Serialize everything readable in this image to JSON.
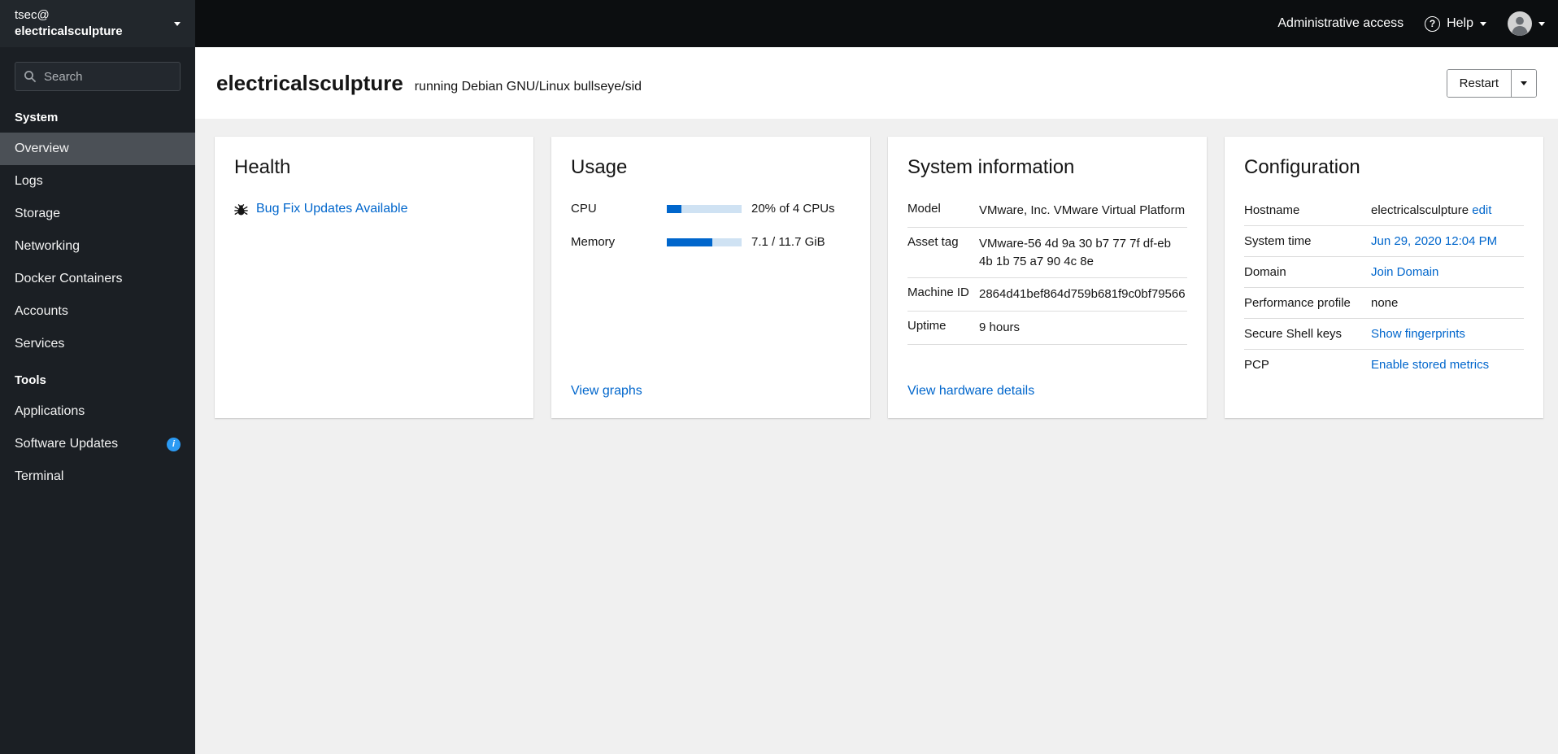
{
  "colors": {
    "link": "#0066cc",
    "progress_fill": "#0066cc",
    "progress_track": "#cfe2f3",
    "info_badge": "#2b9af3",
    "sidebar_active_bg": "#4b5056",
    "topbar_bg": "#0c0e10",
    "sidebar_bg": "#1b1f24"
  },
  "icons": {
    "search-icon": "magnifier",
    "chevron-down-icon": "caret-down-triangle",
    "help-icon": "question-circle",
    "avatar-icon": "user-silhouette",
    "bug-icon": "bug",
    "info-icon": "i-circle"
  },
  "topbar": {
    "administrative_access_label": "Administrative access",
    "help_label": "Help"
  },
  "sidebar": {
    "host_switcher": {
      "user": "tsec@",
      "host": "electricalsculpture"
    },
    "search": {
      "placeholder": "Search"
    },
    "sections": [
      {
        "label": "System",
        "items": [
          "Overview",
          "Logs",
          "Storage",
          "Networking",
          "Docker Containers",
          "Accounts",
          "Services"
        ]
      },
      {
        "label": "Tools",
        "items": [
          "Applications",
          "Software Updates",
          "Terminal"
        ]
      }
    ],
    "active_item": "Overview"
  },
  "header": {
    "hostname": "electricalsculpture",
    "os_release": "running Debian GNU/Linux bullseye/sid",
    "restart_label": "Restart"
  },
  "cards": {
    "health": {
      "title": "Health",
      "updates_link": "Bug Fix Updates Available"
    },
    "usage": {
      "title": "Usage",
      "rows": [
        {
          "label": "CPU",
          "value": "20% of 4 CPUs",
          "percent": 20
        },
        {
          "label": "Memory",
          "value": "7.1 / 11.7 GiB",
          "percent": 61
        }
      ],
      "view_graphs_link": "View graphs"
    },
    "system_information": {
      "title": "System information",
      "rows": [
        {
          "label": "Model",
          "value": "VMware, Inc. VMware Virtual Platform"
        },
        {
          "label": "Asset tag",
          "value": "VMware-56 4d 9a 30 b7 77 7f df-eb 4b 1b 75 a7 90 4c 8e"
        },
        {
          "label": "Machine ID",
          "value": "2864d41bef864d759b681f9c0bf79566"
        },
        {
          "label": "Uptime",
          "value": "9 hours"
        }
      ],
      "view_hardware_link": "View hardware details"
    },
    "configuration": {
      "title": "Configuration",
      "rows": [
        {
          "label": "Hostname",
          "value": "electricalsculpture",
          "link": "edit"
        },
        {
          "label": "System time",
          "link": "Jun 29, 2020 12:04 PM"
        },
        {
          "label": "Domain",
          "link": "Join Domain"
        },
        {
          "label": "Performance profile",
          "value": "none"
        },
        {
          "label": "Secure Shell keys",
          "link": "Show fingerprints"
        },
        {
          "label": "PCP",
          "link": "Enable stored metrics"
        }
      ]
    }
  }
}
